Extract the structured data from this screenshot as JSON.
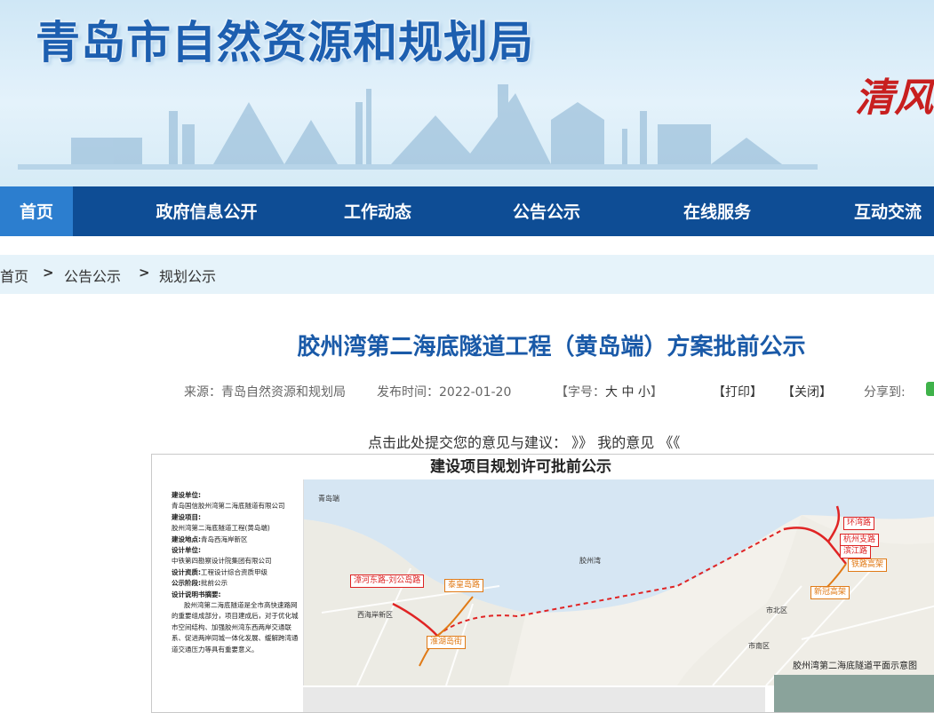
{
  "header": {
    "site_title": "青岛市自然资源和规划局",
    "slogan": "清风"
  },
  "nav": {
    "items": [
      {
        "label": "首页",
        "active": true
      },
      {
        "label": "政府信息公开"
      },
      {
        "label": "工作动态"
      },
      {
        "label": "公告公示"
      },
      {
        "label": "在线服务"
      },
      {
        "label": "互动交流"
      }
    ]
  },
  "breadcrumb": [
    "首页",
    "公告公示",
    "规划公示"
  ],
  "article": {
    "title": "胶州湾第二海底隧道工程（黄岛端）方案批前公示",
    "source": "来源：青岛自然资源和规划局",
    "publish_time": "发布时间：2022-01-20",
    "font_size_label": "【字号：",
    "font_size_options": [
      "大",
      "中",
      "小"
    ],
    "font_size_close": "】",
    "print": "【打印】",
    "close": "【关闭】",
    "share": "分享到:",
    "feedback_prefix": "点击此处提交您的意见与建议：",
    "feedback_arrows_right": "》》",
    "feedback_link": "我的意见",
    "feedback_arrows_left": "《《"
  },
  "notice": {
    "title": "建设项目规划许可批前公示",
    "fields": [
      {
        "label": "建设单位:",
        "value": "青岛国信胶州湾第二海底隧道有限公司"
      },
      {
        "label": "建设项目:",
        "value": "胶州湾第二海底隧道工程(黄岛端)"
      },
      {
        "label": "建设地点:",
        "value": "青岛西海岸新区",
        "inline": true
      },
      {
        "label": "设计单位:",
        "value": "中铁第四勘察设计院集团有限公司"
      },
      {
        "label": "设计资质:",
        "value": "工程设计综合资质甲级",
        "inline": true
      },
      {
        "label": "公示阶段:",
        "value": "批前公示",
        "inline": true
      },
      {
        "label": "设计说明书摘要:",
        "value": ""
      }
    ],
    "description": "胶州湾第二海底隧道是全市高快速路网的重要组成部分，项目建成后，对于优化城市空间结构、加强胶州湾东西两岸交通联系、促进两岸同城一体化发展、缓解跨湾通道交通压力等具有重要意义。",
    "map": {
      "caption": "胶州湾第二海底隧道平面示意图",
      "labels_red": [
        "漳河东路-刘公岛路",
        "环湾路",
        "杭州支路",
        "滨江路"
      ],
      "labels_orange": [
        "泰皇岛路",
        "淮湖岛街",
        "铁路高架",
        "新冠高架"
      ],
      "areas": [
        "青岛端",
        "胶州湾",
        "西海岸新区",
        "市北区",
        "市南区"
      ]
    }
  },
  "colors": {
    "nav_bg": "#0e4d95",
    "nav_active": "#2c7ecf",
    "title_blue": "#1a5aa8",
    "route_red": "#e02424",
    "route_orange": "#e07a16"
  }
}
